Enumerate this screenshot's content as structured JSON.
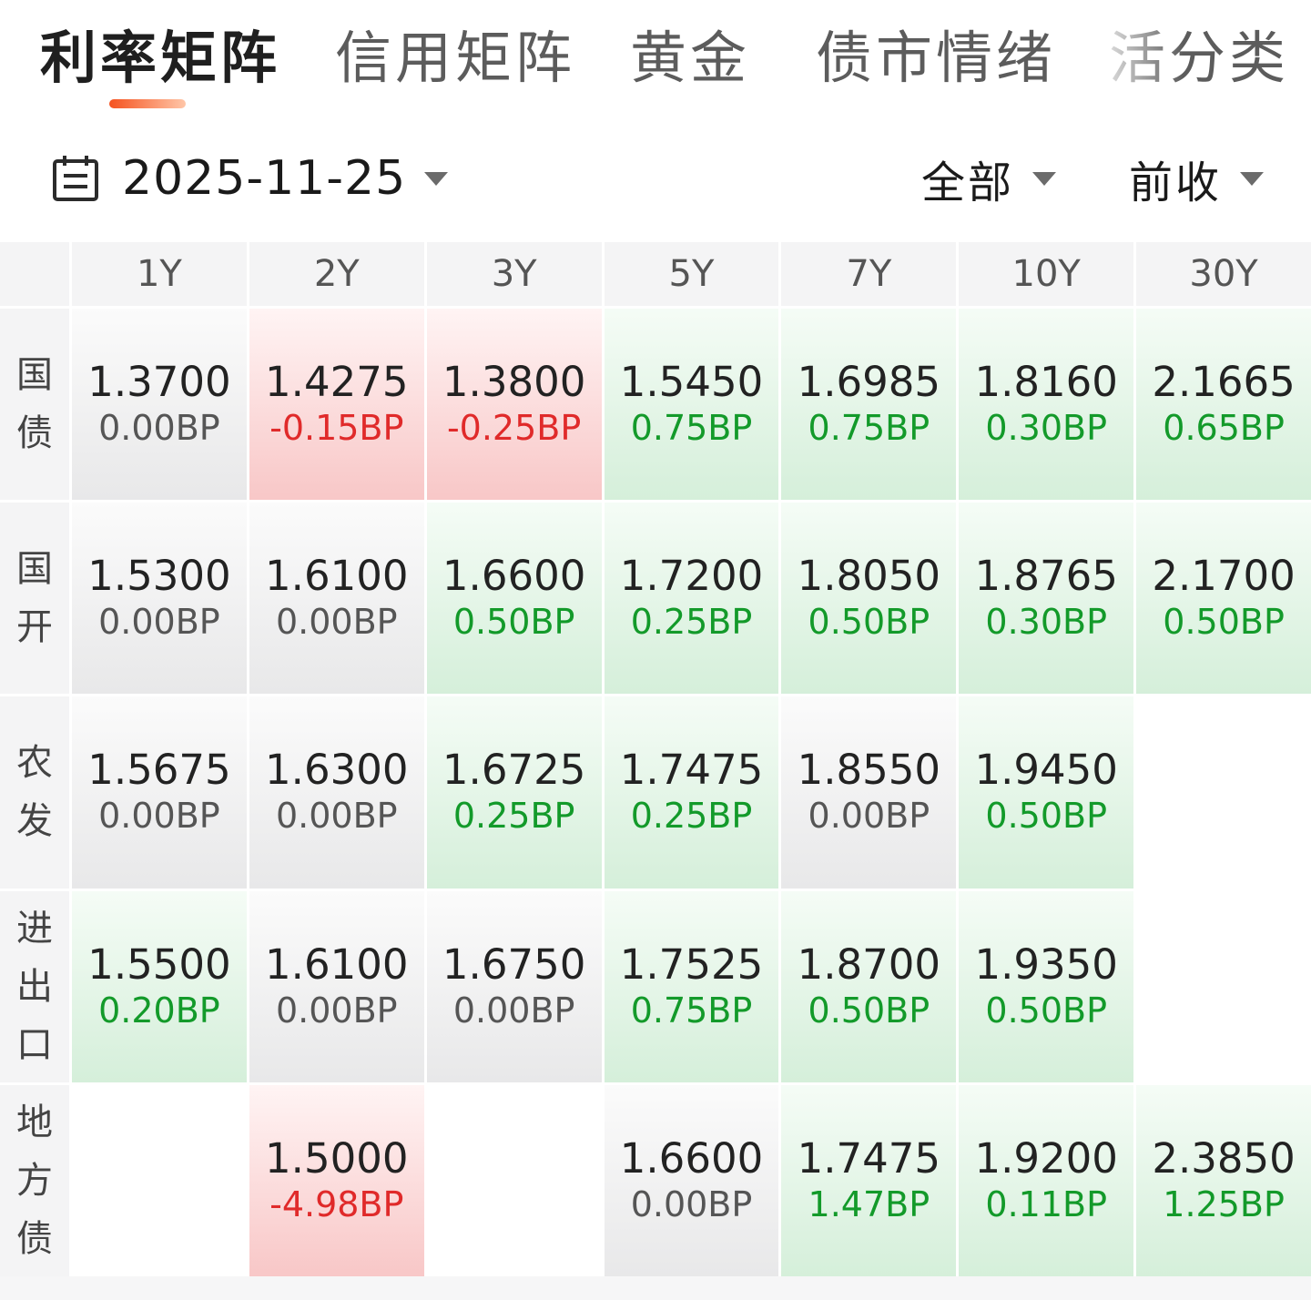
{
  "tabs": [
    {
      "label": "利率矩阵",
      "active": true
    },
    {
      "label": "信用矩阵",
      "active": false
    },
    {
      "label": "黄金",
      "active": false
    },
    {
      "label": "债市情绪",
      "active": false
    },
    {
      "label": "活分类",
      "active": false
    }
  ],
  "toolbar": {
    "date": "2025-11-25",
    "filter_label": "全部",
    "compare_label": "前收"
  },
  "matrix": {
    "columns": [
      "1Y",
      "2Y",
      "3Y",
      "5Y",
      "7Y",
      "10Y",
      "30Y"
    ],
    "rows": [
      {
        "label": "国债",
        "cells": [
          {
            "rate": "1.3700",
            "change": "0.00BP",
            "trend": "flat"
          },
          {
            "rate": "1.4275",
            "change": "-0.15BP",
            "trend": "up"
          },
          {
            "rate": "1.3800",
            "change": "-0.25BP",
            "trend": "up"
          },
          {
            "rate": "1.5450",
            "change": "0.75BP",
            "trend": "down"
          },
          {
            "rate": "1.6985",
            "change": "0.75BP",
            "trend": "down"
          },
          {
            "rate": "1.8160",
            "change": "0.30BP",
            "trend": "down"
          },
          {
            "rate": "2.1665",
            "change": "0.65BP",
            "trend": "down"
          }
        ]
      },
      {
        "label": "国开",
        "cells": [
          {
            "rate": "1.5300",
            "change": "0.00BP",
            "trend": "flat"
          },
          {
            "rate": "1.6100",
            "change": "0.00BP",
            "trend": "flat"
          },
          {
            "rate": "1.6600",
            "change": "0.50BP",
            "trend": "down"
          },
          {
            "rate": "1.7200",
            "change": "0.25BP",
            "trend": "down"
          },
          {
            "rate": "1.8050",
            "change": "0.50BP",
            "trend": "down"
          },
          {
            "rate": "1.8765",
            "change": "0.30BP",
            "trend": "down"
          },
          {
            "rate": "2.1700",
            "change": "0.50BP",
            "trend": "down"
          }
        ]
      },
      {
        "label": "农发",
        "cells": [
          {
            "rate": "1.5675",
            "change": "0.00BP",
            "trend": "flat"
          },
          {
            "rate": "1.6300",
            "change": "0.00BP",
            "trend": "flat"
          },
          {
            "rate": "1.6725",
            "change": "0.25BP",
            "trend": "down"
          },
          {
            "rate": "1.7475",
            "change": "0.25BP",
            "trend": "down"
          },
          {
            "rate": "1.8550",
            "change": "0.00BP",
            "trend": "flat"
          },
          {
            "rate": "1.9450",
            "change": "0.50BP",
            "trend": "down"
          },
          null
        ]
      },
      {
        "label": "进出口",
        "cells": [
          {
            "rate": "1.5500",
            "change": "0.20BP",
            "trend": "down"
          },
          {
            "rate": "1.6100",
            "change": "0.00BP",
            "trend": "flat"
          },
          {
            "rate": "1.6750",
            "change": "0.00BP",
            "trend": "flat"
          },
          {
            "rate": "1.7525",
            "change": "0.75BP",
            "trend": "down"
          },
          {
            "rate": "1.8700",
            "change": "0.50BP",
            "trend": "down"
          },
          {
            "rate": "1.9350",
            "change": "0.50BP",
            "trend": "down"
          },
          null
        ]
      },
      {
        "label": "地方债",
        "cells": [
          null,
          {
            "rate": "1.5000",
            "change": "-4.98BP",
            "trend": "up"
          },
          null,
          {
            "rate": "1.6600",
            "change": "0.00BP",
            "trend": "flat"
          },
          {
            "rate": "1.7475",
            "change": "1.47BP",
            "trend": "down"
          },
          {
            "rate": "1.9200",
            "change": "0.11BP",
            "trend": "down"
          },
          {
            "rate": "2.3850",
            "change": "1.25BP",
            "trend": "down"
          }
        ]
      }
    ]
  },
  "colors": {
    "accent": "#f5521f",
    "rise_red": "#e02a2a",
    "fall_green": "#139a2a"
  },
  "icons": {
    "date": "calendar-icon",
    "dropdown": "caret-down-icon"
  }
}
